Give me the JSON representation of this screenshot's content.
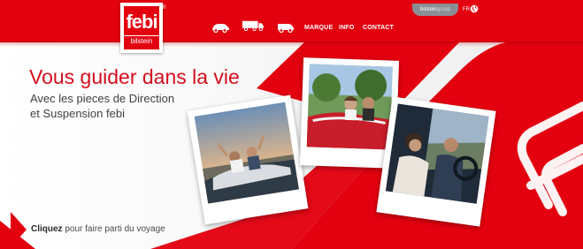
{
  "nav": {
    "links": [
      "MARQUE",
      "INFO",
      "CONTACT"
    ],
    "vehicle_icons": [
      "car-icon",
      "truck-icon",
      "van-icon"
    ],
    "group_pill": {
      "brand": "bilstein",
      "suffix": "group"
    },
    "language": "FR"
  },
  "logo": {
    "name": "febi",
    "sub": "bilstein",
    "mark": "®"
  },
  "hero": {
    "headline": "Vous guider dans la vie",
    "sub_lines": [
      "Avec les pieces de Direction",
      "et Suspension febi"
    ],
    "cta_strong": "Cliquez",
    "cta_rest": " pour faire parti du voyage"
  },
  "colors": {
    "brand_red": "#e3000f",
    "headline_red": "#d20f1d",
    "text_grey": "#414141"
  }
}
